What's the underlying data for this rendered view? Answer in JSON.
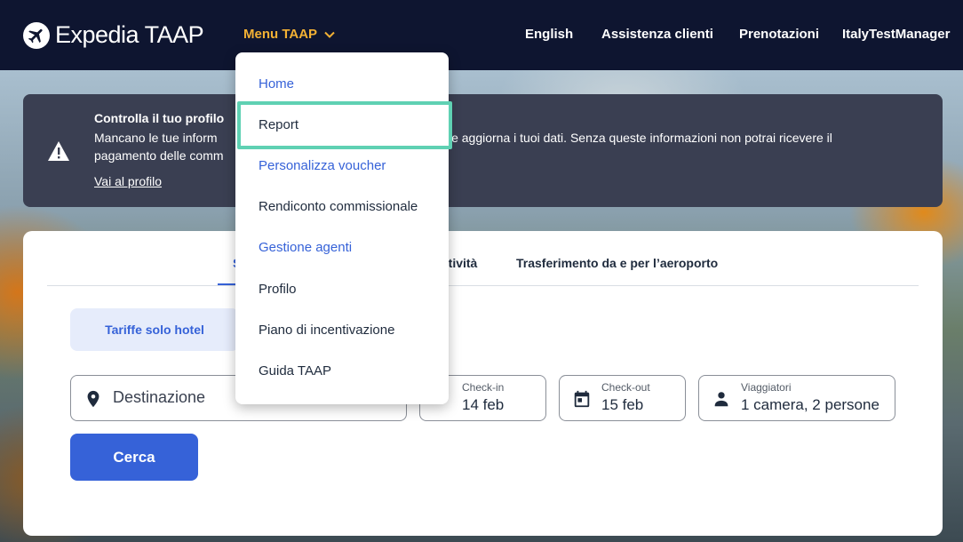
{
  "nav": {
    "logo_text": "Expedia TAAP",
    "menu_label": "Menu TAAP",
    "language": "English",
    "support": "Assistenza clienti",
    "bookings": "Prenotazioni",
    "user": "ItalyTestManager"
  },
  "menu": {
    "items": [
      {
        "label": "Home"
      },
      {
        "label": "Report"
      },
      {
        "label": "Personalizza voucher"
      },
      {
        "label": "Rendiconto commissionale"
      },
      {
        "label": "Gestione agenti"
      },
      {
        "label": "Profilo"
      },
      {
        "label": "Piano di incentivazione"
      },
      {
        "label": "Guida TAAP"
      }
    ],
    "highlighted": "Report"
  },
  "alert": {
    "title": "Controlla il tuo profilo",
    "body": "Mancano le tue informazioni. Vai su “Profilo” e aggiorna i tuoi dati. Senza queste informazioni non potrai ricevere il pagamento delle commissioni.",
    "body_visible_right": "” e aggiorna i tuoi dati. Senza queste informazioni non potrai ricevere il",
    "body_line1_left": "Mancano le tue inform",
    "body_line2_left": "pagamento delle comm",
    "link": "Vai al profilo"
  },
  "search": {
    "tabs": {
      "first_fragment": "S",
      "activities_fragment": "ttività",
      "airport": "Trasferimento da e per l’aeroporto"
    },
    "rate_pill": "Tariffe solo hotel",
    "destination_placeholder": "Destinazione",
    "checkin": {
      "label": "Check-in",
      "value": "14 feb"
    },
    "checkout": {
      "label": "Check-out",
      "value": "15 feb"
    },
    "travelers": {
      "label": "Viaggiatori",
      "value": "1 camera, 2 persone"
    },
    "button": "Cerca"
  },
  "colors": {
    "nav_bg": "#0e1530",
    "menu_accent": "#f3b134",
    "primary": "#3662d8",
    "alert_bg": "#3a3f52",
    "highlight": "#5fd1b3"
  }
}
